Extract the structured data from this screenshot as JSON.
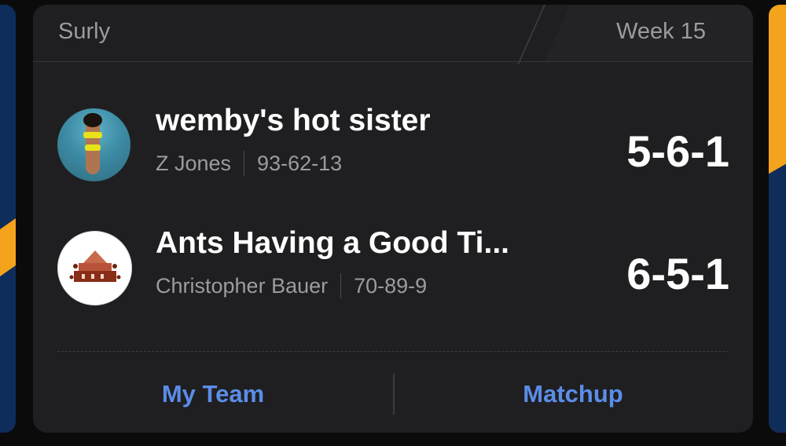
{
  "header": {
    "league_name": "Surly",
    "week_label": "Week 15"
  },
  "matchup": {
    "teams": [
      {
        "name": "wemby's hot sister",
        "manager": "Z Jones",
        "season_record": "93-62-13",
        "score": "5-6-1",
        "avatar_icon": "beach-photo-avatar"
      },
      {
        "name": "Ants Having a Good Ti...",
        "manager": "Christopher Bauer",
        "season_record": "70-89-9",
        "score": "6-5-1",
        "avatar_icon": "ants-illustration-avatar"
      }
    ]
  },
  "footer": {
    "my_team_label": "My Team",
    "matchup_label": "Matchup"
  },
  "colors": {
    "card_bg": "#1f1f21",
    "link_blue": "#5b8de8",
    "text_muted": "#9b9ba0",
    "peek_navy": "#0f2d5a",
    "peek_gold": "#f4a31c"
  }
}
